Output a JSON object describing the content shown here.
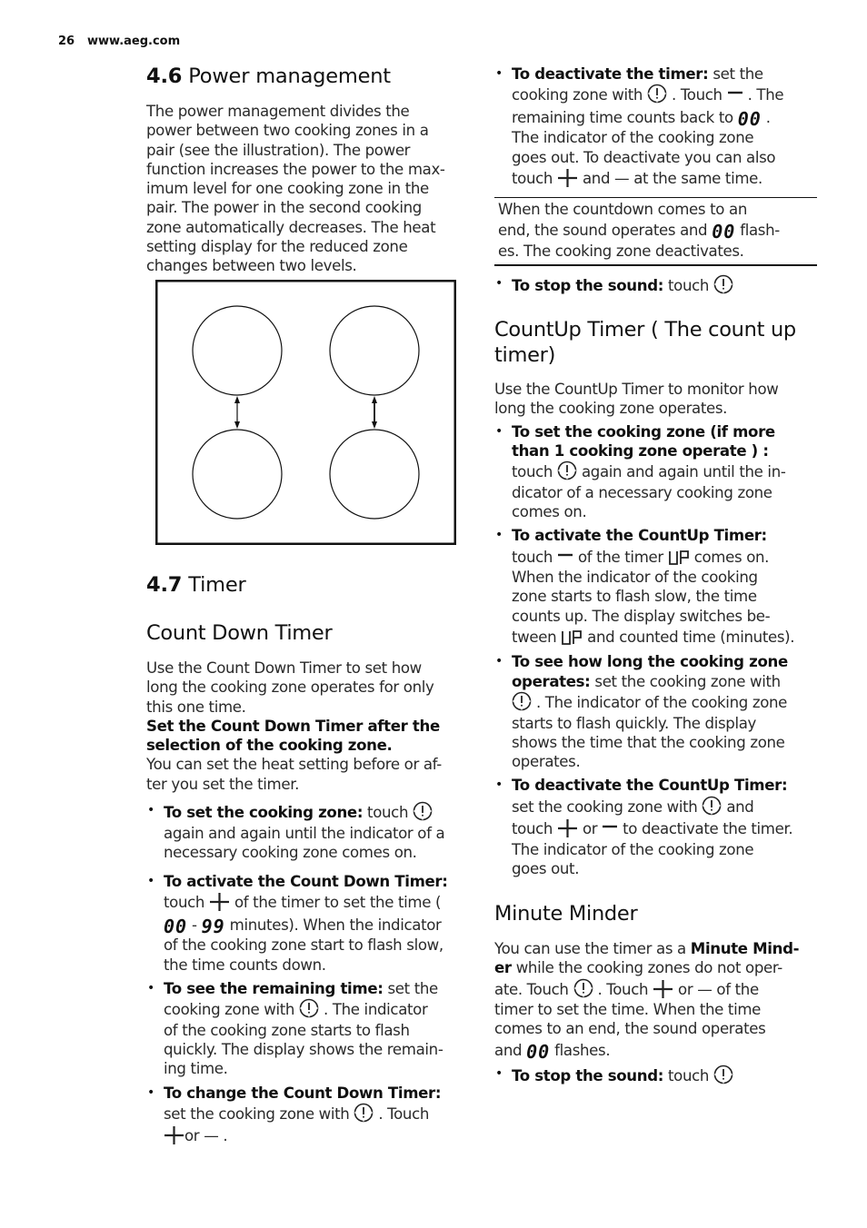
{
  "header": {
    "page_number": "26",
    "url": "www.aeg.com"
  },
  "section_4_6": {
    "number": "4.6",
    "title": "Power management",
    "body_lines": [
      "The power management divides the",
      "power between two cooking zones in a",
      "pair (see the illustration). The power",
      "function increases the power to the max-",
      "imum level for one cooking zone in the",
      "pair. The power in the second cooking",
      "zone automatically decreases. The heat",
      "setting display for the reduced zone",
      "changes between two levels."
    ],
    "illustration": {
      "description": "Hob with four cooking zones in two pairs",
      "zones": 4,
      "pairs": [
        [
          "front-left",
          "rear-left"
        ],
        [
          "front-right",
          "rear-right"
        ]
      ]
    }
  },
  "section_4_7": {
    "number": "4.7",
    "title": "Timer"
  },
  "count_down": {
    "title": "Count Down Timer",
    "intro_lines": [
      "Use the Count Down Timer to set how",
      "long the cooking zone operates for only",
      "this one time."
    ],
    "bold_lines": [
      "Set the Count Down Timer after the",
      "selection of the cooking zone."
    ],
    "note_lines": [
      "You can set the heat setting before or af-",
      "ter you set the timer."
    ],
    "set_zone": {
      "label": "To set the cooking zone:",
      "t1": "touch",
      "l2": "again and again until the indicator of a",
      "l3": "necessary cooking zone comes on."
    },
    "activate": {
      "label": "To activate the Count Down Timer:",
      "t1": "touch",
      "t2": "of the timer to set the time (",
      "display_min": "00",
      "dash": "-",
      "display_max": "99",
      "t3": "minutes). When the indicator",
      "l3": "of the cooking zone start to flash slow,",
      "l4": "the time counts down."
    },
    "remaining": {
      "label": "To see the remaining time:",
      "t1": "set the",
      "l2a": "cooking zone with",
      "l2b": ". The indicator",
      "l3": "of the cooking zone starts to flash",
      "l4": "quickly. The display shows the remain-",
      "l5": "ing time."
    },
    "change": {
      "label": "To change the Count Down Timer:",
      "l2a": "set the cooking zone with",
      "l2b": ". Touch",
      "l3": "or — ."
    },
    "deactivate": {
      "label": "To deactivate the timer:",
      "t1": "set the",
      "l2a": "cooking zone with",
      "l2b": ". Touch",
      "l2c": ". The",
      "l3a": "remaining time counts back to",
      "display": "00",
      "l3b": ".",
      "l4": "The indicator of the cooking zone",
      "l5": "goes out. To deactivate you can also",
      "l6a": "touch",
      "l6b": "and — at the same time."
    },
    "end_note": {
      "l1": "When the countdown comes to an",
      "l2a": "end, the sound operates and",
      "display": "00",
      "l2b": "flash-",
      "l3": "es. The cooking zone deactivates."
    },
    "stop_sound": {
      "label": "To stop the sound:",
      "t1": "touch"
    }
  },
  "count_up": {
    "title_l1": "CountUp Timer ( The count up",
    "title_l2": "timer)",
    "intro_lines": [
      "Use the CountUp Timer to monitor how",
      "long the cooking zone operates."
    ],
    "set_zone": {
      "label_l1": "To set the cooking zone (if more",
      "label_l2": "than 1 cooking zone operate ) :",
      "l3a": "touch",
      "l3b": "again and again until the in-",
      "l4": "dicator of a necessary cooking zone",
      "l5": "comes on."
    },
    "activate": {
      "label": "To activate the CountUp Timer:",
      "l2a": "touch",
      "l2b": "of the timer",
      "display": "UP",
      "l2c": "comes on.",
      "l3": "When the indicator of the cooking",
      "l4": "zone starts to flash slow, the time",
      "l5": "counts up. The display switches be-",
      "l6a": "tween",
      "l6b": "and counted time (minutes)."
    },
    "see_time": {
      "label_l1": "To see how long the cooking zone",
      "label_l2": "operates:",
      "l2b": "set the cooking zone with",
      "l3": ". The indicator of the cooking zone",
      "l4": "starts to flash quickly. The display",
      "l5": "shows the time that the cooking zone",
      "l6": "operates."
    },
    "deactivate": {
      "label": "To deactivate the CountUp Timer:",
      "l2a": "set the cooking zone with",
      "l2b": "and",
      "l3a": "touch",
      "l3b": "or",
      "l3c": "to deactivate the timer.",
      "l4": "The indicator of the cooking zone",
      "l5": "goes out."
    }
  },
  "minute_minder": {
    "title": "Minute Minder",
    "l1a": "You can use the timer as a",
    "l1b": "Minute Mind-",
    "l2a": "er",
    "l2b": "while the cooking zones do not oper-",
    "l3a": "ate. Touch",
    "l3b": ". Touch",
    "l3c": "or — of the",
    "l4": "timer to set the time. When the time",
    "l5": "comes to an end, the sound operates",
    "l6a": "and",
    "display": "00",
    "l6b": "flashes.",
    "stop_sound": {
      "label": "To stop the sound:",
      "t1": "touch"
    }
  }
}
